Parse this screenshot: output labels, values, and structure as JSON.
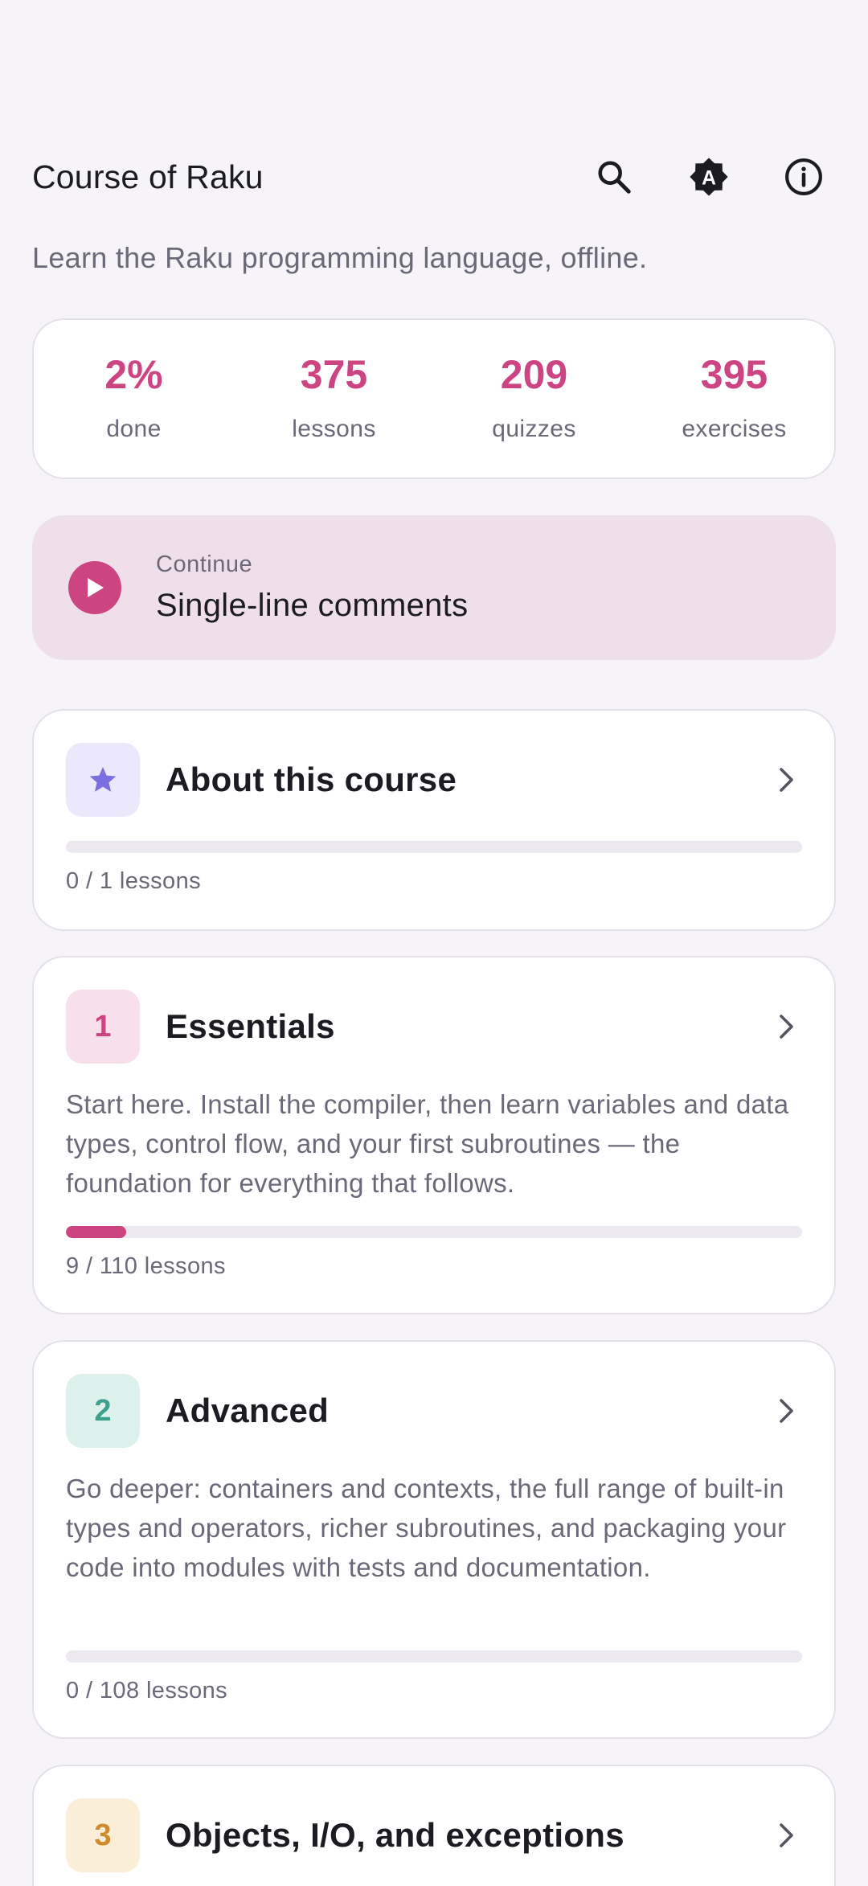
{
  "header": {
    "title": "Course of Raku",
    "icons": [
      "search-icon",
      "theme-auto-icon",
      "info-icon"
    ],
    "theme_icon_letter": "A"
  },
  "subtitle": "Learn the Raku programming language, offline.",
  "stats": [
    {
      "value": "2%",
      "label": "done"
    },
    {
      "value": "375",
      "label": "lessons"
    },
    {
      "value": "209",
      "label": "quizzes"
    },
    {
      "value": "395",
      "label": "exercises"
    }
  ],
  "continue": {
    "label": "Continue",
    "title": "Single-line comments"
  },
  "colors": {
    "accent": "#cc4582",
    "background": "#f6f4f9",
    "continue_bg": "#efdfeb"
  },
  "sections": [
    {
      "badge": "",
      "badge_icon": "star-icon",
      "title": "About this course",
      "description": "",
      "progress_fraction": 0.0,
      "progress_text": "0 / 1 lessons",
      "badge_bg": "#ece8fb",
      "badge_color": "#7b6fe0"
    },
    {
      "badge": "1",
      "title": "Essentials",
      "description": "Start here. Install the compiler, then learn variables and data types, control flow, and your first subroutines — the foundation for everything that follows.",
      "progress_fraction": 0.0818,
      "progress_text": "9 / 110 lessons",
      "badge_bg": "#f7e0ec",
      "badge_color": "#cc4582"
    },
    {
      "badge": "2",
      "title": "Advanced",
      "description": "Go deeper: containers and contexts, the full range of built-in types and operators, richer subroutines, and packaging your code into modules with tests and documentation.",
      "progress_fraction": 0.0,
      "progress_text": "0 / 108 lessons",
      "badge_bg": "#dcf1ec",
      "badge_color": "#3e9f8c"
    },
    {
      "badge": "3",
      "title": "Objects, I/O, and exceptions",
      "description": "",
      "progress_fraction": 0.0,
      "progress_text": "",
      "badge_bg": "#fbeed8",
      "badge_color": "#d08a2e"
    }
  ]
}
